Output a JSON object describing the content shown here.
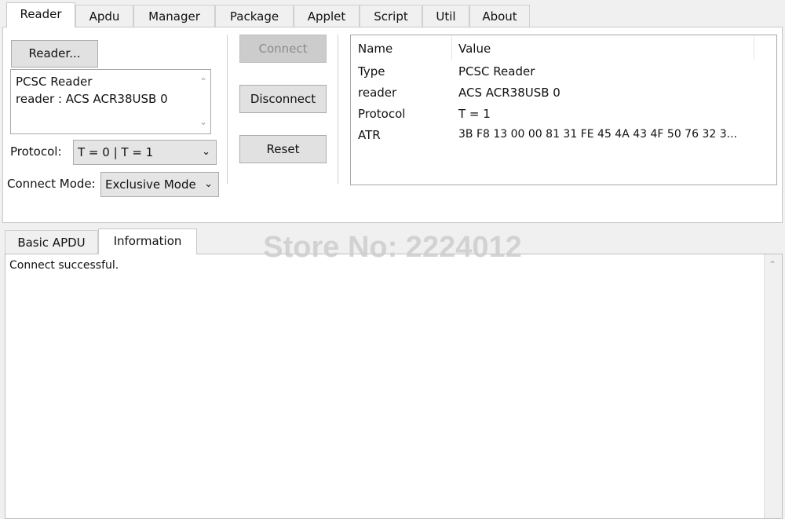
{
  "top_tabs": [
    "Reader",
    "Apdu",
    "Manager",
    "Package",
    "Applet",
    "Script",
    "Util",
    "About"
  ],
  "reader_panel": {
    "reader_button": "Reader...",
    "reader_list": [
      "PCSC Reader",
      "reader : ACS ACR38USB 0"
    ],
    "protocol_label": "Protocol:",
    "protocol_value": "T = 0 | T = 1",
    "connect_mode_label": "Connect Mode:",
    "connect_mode_value": "Exclusive Mode",
    "connect_button": "Connect",
    "disconnect_button": "Disconnect",
    "reset_button": "Reset"
  },
  "info_table": {
    "headers": [
      "Name",
      "Value"
    ],
    "rows": [
      {
        "name": "Type",
        "value": "PCSC Reader"
      },
      {
        "name": "reader",
        "value": "ACS ACR38USB 0"
      },
      {
        "name": "Protocol",
        "value": "T = 1"
      },
      {
        "name": "ATR",
        "value": "3B F8 13 00 00 81 31 FE 45 4A 43 4F 50 76 32 3..."
      }
    ]
  },
  "bottom_tabs": [
    "Basic APDU",
    "Information"
  ],
  "output": {
    "text": "Connect successful."
  },
  "watermark": "Store No: 2224012",
  "icons": {
    "dropdown": "chevron-down-icon",
    "scroll_up": "chevron-up-icon",
    "scroll_down": "chevron-down-icon"
  }
}
